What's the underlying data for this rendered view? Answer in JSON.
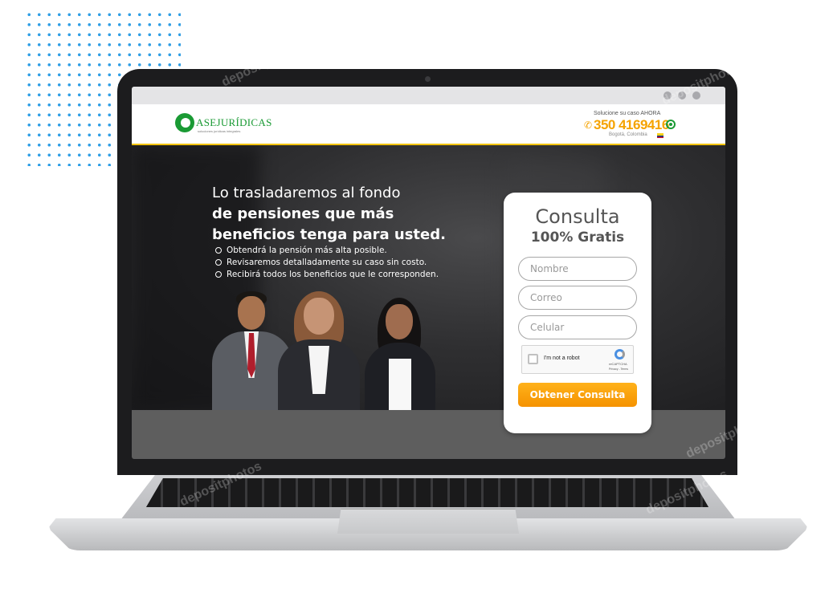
{
  "site": {
    "logo_text": "ASEJURÍDICAS",
    "logo_tagline": "soluciones jurídicas integrales",
    "header_cta": "Solucione su caso AHORA",
    "phone": "350 4169416",
    "location": "Bogotá, Colombia"
  },
  "hero": {
    "title_line1": "Lo trasladaremos al fondo",
    "title_line2": "de pensiones que más",
    "title_line3": "beneficios tenga para usted.",
    "benefits": [
      "Obtendrá la pensión más alta posible.",
      "Revisaremos detalladamente su caso sin costo.",
      "Recibirá todos los beneficios que le corresponden."
    ]
  },
  "form": {
    "title": "Consulta",
    "subtitle": "100% Gratis",
    "name_placeholder": "Nombre",
    "email_placeholder": "Correo",
    "phone_placeholder": "Celular",
    "captcha_label": "I'm not a robot",
    "captcha_brand": "reCAPTCHA",
    "captcha_terms": "Privacy - Terms",
    "submit_label": "Obtener Consulta"
  },
  "watermark": "depositphotos",
  "colors": {
    "brand_green": "#1a9a34",
    "accent_orange": "#f5a300",
    "dots_blue": "#2f9fe6"
  },
  "icons": [
    "phone-icon",
    "whatsapp-icon",
    "check-circle-icon",
    "recaptcha-icon",
    "colombia-flag-icon"
  ]
}
